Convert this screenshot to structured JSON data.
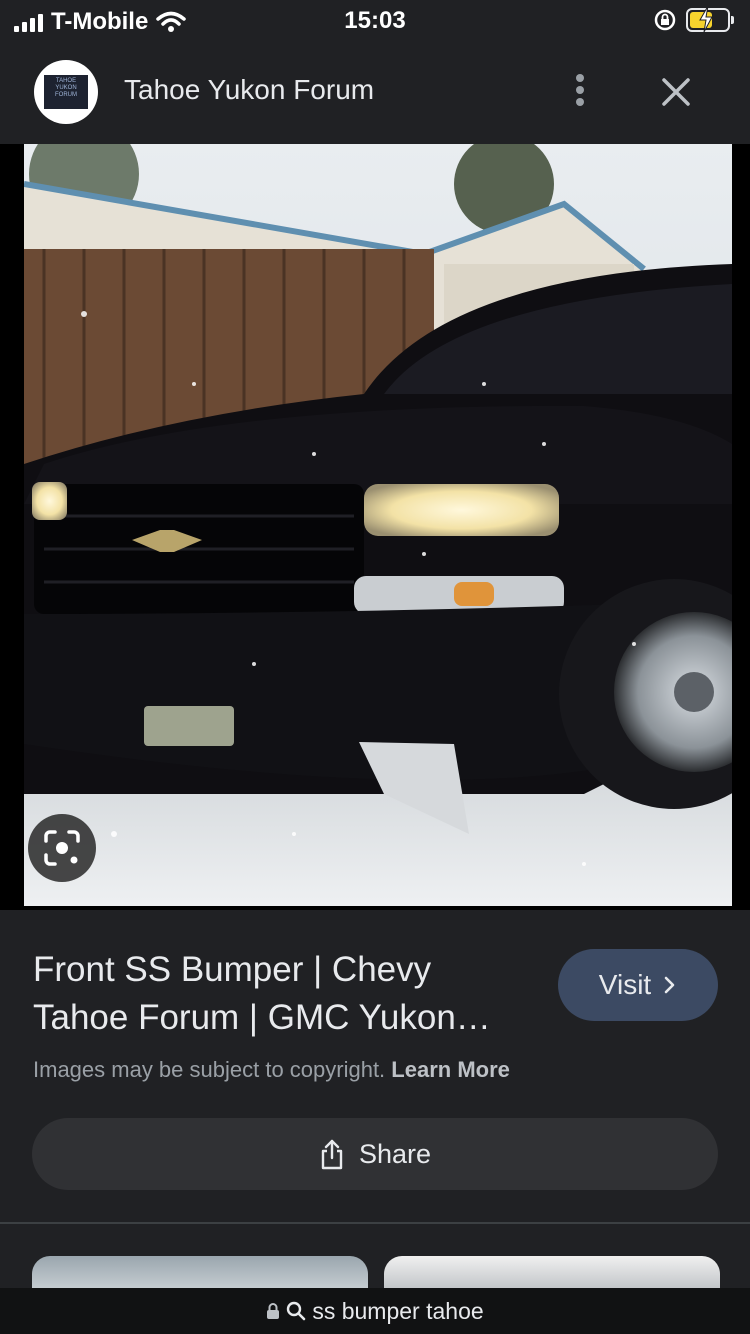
{
  "status_bar": {
    "carrier": "T-Mobile",
    "time": "15:03",
    "signal_bars": 4,
    "battery_state": "charging"
  },
  "header": {
    "site_name": "Tahoe Yukon Forum",
    "logo_text": [
      "TAHOE",
      "YUKON",
      "FORUM"
    ],
    "menu_icon": "more-vert-icon",
    "close_icon": "close-icon"
  },
  "image": {
    "lens_icon": "google-lens-icon"
  },
  "result": {
    "title_line1": "Front SS Bumper | Chevy",
    "title_line2": "Tahoe Forum | GMC Yukon…",
    "visit_label": "Visit",
    "copyright_text": "Images may be subject to copyright.",
    "learn_more": "Learn More",
    "share_label": "Share"
  },
  "url_bar": {
    "text": "ss bumper tahoe"
  },
  "colors": {
    "background": "#202124",
    "visit_button": "#3c4a63",
    "share_button": "#303134",
    "battery_fill": "#f6d32d"
  }
}
